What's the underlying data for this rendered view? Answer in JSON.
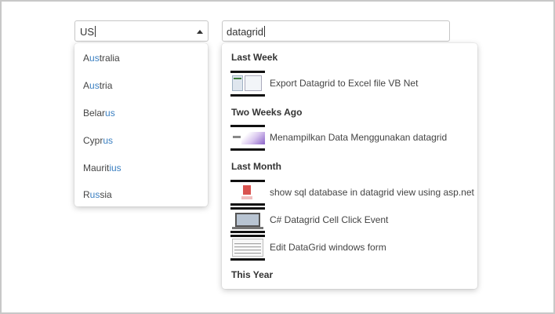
{
  "combo": {
    "value": "US",
    "items": [
      {
        "pre": "A",
        "match": "us",
        "post": "tralia"
      },
      {
        "pre": "A",
        "match": "us",
        "post": "tria"
      },
      {
        "pre": "Belar",
        "match": "us",
        "post": ""
      },
      {
        "pre": "Cypr",
        "match": "us",
        "post": ""
      },
      {
        "pre": "Maurit",
        "match": "ius",
        "post": ""
      },
      {
        "pre": "R",
        "match": "us",
        "post": "sia"
      }
    ]
  },
  "autocomplete": {
    "value": "datagrid",
    "groups": {
      "last_week": "Last Week",
      "two_weeks_ago": "Two Weeks Ago",
      "last_month": "Last Month",
      "this_year": "This Year"
    },
    "results": [
      {
        "label": "Export Datagrid to Excel file VB Net"
      },
      {
        "label": "Menampilkan Data Menggunakan datagrid"
      },
      {
        "label": "show sql database in datagrid view using asp.net"
      },
      {
        "label": "C# Datagrid Cell Click Event"
      },
      {
        "label": "Edit DataGrid windows form"
      }
    ]
  },
  "colors": {
    "highlight": "#3a7fc1",
    "border": "#c6c6c6"
  }
}
